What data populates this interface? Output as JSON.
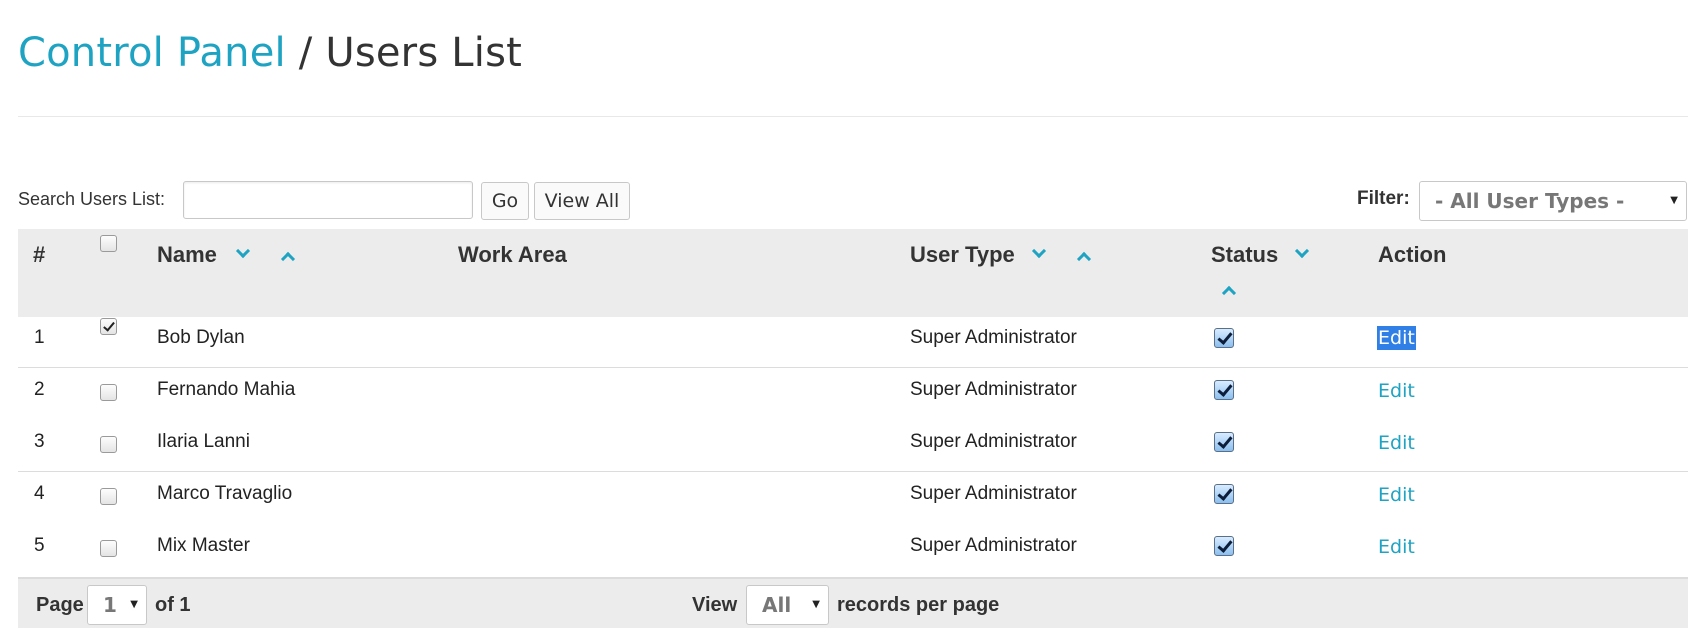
{
  "header": {
    "breadcrumb_link": "Control Panel",
    "separator": " / ",
    "current": "Users List"
  },
  "toolbar": {
    "search_label": "Search Users List:",
    "search_value": "",
    "go_label": "Go",
    "view_all_label": "View All",
    "filter_label": "Filter:",
    "filter_selected": "- All User Types -"
  },
  "table": {
    "columns": {
      "index": "#",
      "name": "Name",
      "work_area": "Work Area",
      "user_type": "User Type",
      "status": "Status",
      "action": "Action"
    },
    "rows": [
      {
        "index": "1",
        "selected": true,
        "name": "Bob Dylan",
        "work_area": "",
        "user_type": "Super Administrator",
        "status_active": true,
        "action": "Edit"
      },
      {
        "index": "2",
        "selected": false,
        "name": "Fernando Mahia",
        "work_area": "",
        "user_type": "Super Administrator",
        "status_active": true,
        "action": "Edit"
      },
      {
        "index": "3",
        "selected": false,
        "name": "Ilaria Lanni",
        "work_area": "",
        "user_type": "Super Administrator",
        "status_active": true,
        "action": "Edit"
      },
      {
        "index": "4",
        "selected": false,
        "name": "Marco Travaglio",
        "work_area": "",
        "user_type": "Super Administrator",
        "status_active": true,
        "action": "Edit"
      },
      {
        "index": "5",
        "selected": false,
        "name": "Mix Master",
        "work_area": "",
        "user_type": "Super Administrator",
        "status_active": true,
        "action": "Edit"
      }
    ]
  },
  "pagination": {
    "page_label": "Page",
    "page_value": "1",
    "of_label": "of 1",
    "view_label": "View",
    "view_value": "All",
    "records_label": "records per page"
  },
  "colors": {
    "accent": "#1fa3c3",
    "header_bg": "#ececec",
    "selection": "#2f7fe6"
  },
  "icons": {
    "sort_desc": "chevron-down-icon",
    "sort_asc": "chevron-up-icon",
    "dropdown": "dropdown-arrow-icon"
  }
}
